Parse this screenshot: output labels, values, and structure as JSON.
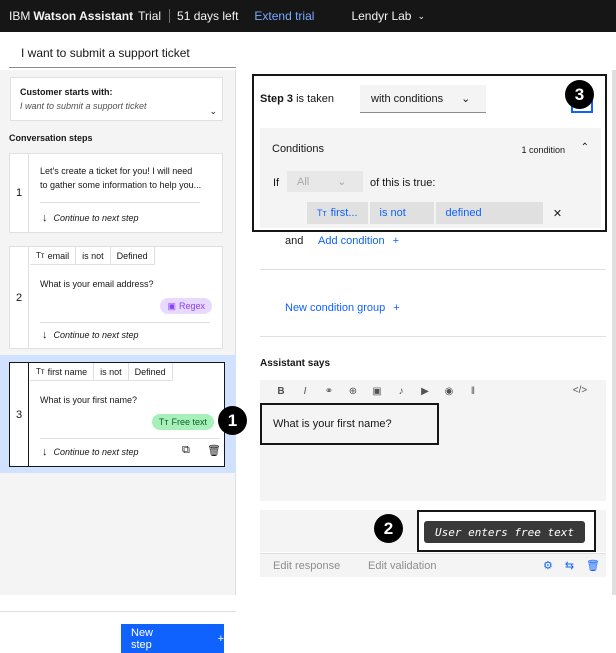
{
  "topbar": {
    "brand_prefix": "IBM",
    "brand_name": "Watson Assistant",
    "plan": "Trial",
    "days_left": "51 days left",
    "extend": "Extend trial",
    "workspace": "Lendyr Lab"
  },
  "action": {
    "title": "I want to submit a support ticket"
  },
  "left": {
    "customer_label": "Customer starts with:",
    "customer_value": "I want to submit a support ticket",
    "conv_steps_label": "Conversation steps",
    "continue_label": "Continue to next step",
    "new_step": "New step",
    "steps": [
      {
        "num": "1",
        "text_line1": "Let's create a ticket for you! I will need",
        "text_line2": "to gather some information to help you..."
      },
      {
        "num": "2",
        "cond_var": "email",
        "cond_op": "is not",
        "cond_val": "Defined",
        "text": "What is your email address?",
        "pill": "Regex"
      },
      {
        "num": "3",
        "cond_var": "first name",
        "cond_op": "is not",
        "cond_val": "Defined",
        "text": "What is your first name?",
        "pill": "Free text"
      }
    ]
  },
  "step_panel": {
    "step_label": "Step 3",
    "taken_label": "is taken",
    "condition_mode": "with conditions",
    "conditions_title": "Conditions",
    "condition_count": "1 condition",
    "if_label": "If",
    "all_label": "All",
    "this_true": "of this is true:",
    "chip_var": "first...",
    "chip_op": "is not",
    "chip_val": "defined"
  },
  "conditions_more": {
    "and_label": "and",
    "add_condition": "Add condition",
    "new_group": "New condition group"
  },
  "assistant": {
    "label": "Assistant says",
    "message": "What is your first name?",
    "tooltip": "User enters free text",
    "tab_edit_response": "Edit response",
    "tab_edit_validation": "Edit validation"
  },
  "callouts": {
    "c1": "1",
    "c2": "2",
    "c3": "3"
  },
  "colors": {
    "accent": "#0f62fe",
    "selected_bg": "#d0e2ff",
    "regex_bg": "#e8daff",
    "free_text_bg": "#a7f0ba"
  }
}
